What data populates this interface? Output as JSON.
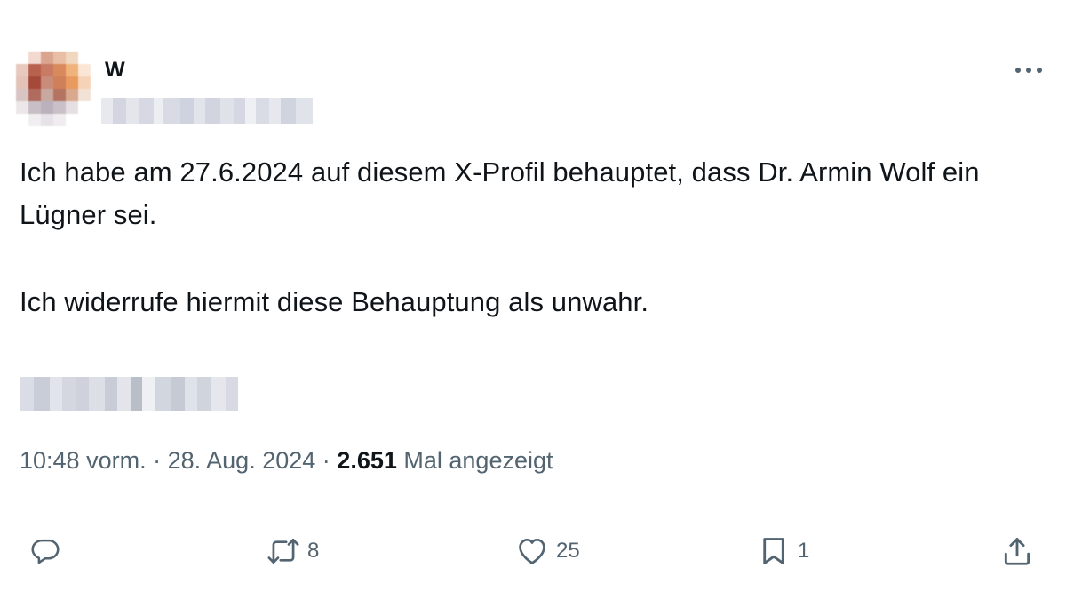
{
  "tweet": {
    "display_name": "W",
    "text_paragraphs": [
      "Ich habe am 27.6.2024 auf diesem X-Profil behauptet, dass Dr. Armin Wolf ein Lügner sei.",
      "Ich widerrufe hiermit diese Behauptung als unwahr."
    ],
    "time": "10:48 vorm.",
    "separator": "·",
    "date": "28. Aug. 2024",
    "views_count": "2.651",
    "views_label": "Mal angezeigt"
  },
  "actions": {
    "reply": {
      "icon": "reply-icon",
      "count": ""
    },
    "retweet": {
      "icon": "retweet-icon",
      "count": "8"
    },
    "like": {
      "icon": "heart-icon",
      "count": "25"
    },
    "bookmark": {
      "icon": "bookmark-icon",
      "count": "1"
    },
    "share": {
      "icon": "share-icon",
      "count": ""
    }
  },
  "colors": {
    "text_primary": "#0f1419",
    "text_secondary": "#536471",
    "divider": "#eff3f4",
    "background": "#ffffff"
  }
}
